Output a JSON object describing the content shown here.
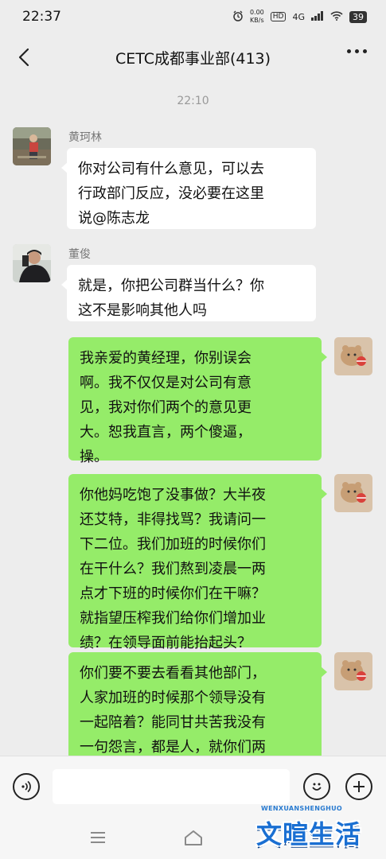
{
  "status_bar": {
    "time": "22:37",
    "net_speed_value": "0.00",
    "net_speed_unit": "KB/s",
    "hd_label": "HD",
    "network": "4G",
    "battery": "39"
  },
  "header": {
    "title": "CETC成都事业部(413)"
  },
  "chat": {
    "timestamp": "22:10",
    "messages": [
      {
        "sender": "黄珂林",
        "side": "left",
        "text": "你对公司有什么意见，可以去\n行政部门反应，没必要在这里\n说@陈志龙"
      },
      {
        "sender": "董俊",
        "side": "left",
        "text": "就是，你把公司群当什么？你\n这不是影响其他人吗"
      },
      {
        "side": "right",
        "text": "我亲爱的黄经理，你别误会\n啊。我不仅仅是对公司有意\n见，我对你们两个的意见更\n大。恕我直言，两个傻逼，\n操。"
      },
      {
        "side": "right",
        "text": "你他妈吃饱了没事做？大半夜\n还艾特，非得找骂？我请问一\n下二位。我们加班的时候你们\n在干什么？我们熬到凌晨一两\n点才下班的时候你们在干嘛？\n就指望压榨我们给你们增加业\n绩？在领导面前能抬起头？"
      },
      {
        "side": "right",
        "text": "你们要不要去看看其他部门，\n人家加班的时候那个领导没有\n一起陪着？能同甘共苦我没有\n一句怨言，都是人，就你们两\n特殊？一天天啥啥不行，吃"
      }
    ]
  },
  "watermark": {
    "small_text": "WENXUANSHENGHUO",
    "big_text": "文暄生活"
  },
  "colors": {
    "background": "#ededed",
    "bubble_sent": "#95ec69",
    "bubble_received": "#ffffff"
  },
  "icons": {
    "back": "chevron-left-icon",
    "more": "more-icon",
    "voice": "voice-icon",
    "emoji": "emoji-icon",
    "add": "plus-icon",
    "nav_menu": "menu-icon",
    "nav_home": "home-icon"
  }
}
